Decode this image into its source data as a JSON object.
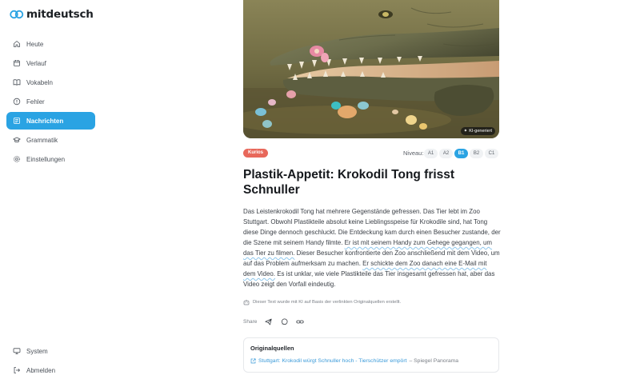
{
  "app": {
    "logo_text": "mitdeutsch"
  },
  "sidebar": {
    "items": [
      {
        "label": "Heute",
        "icon": "home-icon"
      },
      {
        "label": "Verlauf",
        "icon": "calendar-icon"
      },
      {
        "label": "Vokabeln",
        "icon": "book-icon"
      },
      {
        "label": "Fehler",
        "icon": "alert-circle-icon"
      },
      {
        "label": "Nachrichten",
        "icon": "newspaper-icon",
        "active": true
      },
      {
        "label": "Grammatik",
        "icon": "graduation-cap-icon"
      },
      {
        "label": "Einstellungen",
        "icon": "gear-icon"
      }
    ],
    "bottom": [
      {
        "label": "System",
        "icon": "monitor-icon"
      },
      {
        "label": "Abmelden",
        "icon": "logout-icon"
      }
    ]
  },
  "article": {
    "image_badge": "KI-generiert",
    "category": "Kurios",
    "level_label": "Niveau:",
    "levels": [
      "A1",
      "A2",
      "B1",
      "B2",
      "C1"
    ],
    "active_level": "B1",
    "title": "Plastik-Appetit: Krokodil Tong frisst Schnuller",
    "body": {
      "p1": "Das Leistenkrokodil Tong hat mehrere Gegenstände gefressen. Das Tier lebt im Zoo Stuttgart. Obwohl Plastikteile absolut keine Lieblingsspeise für Krokodile sind, hat Tong diese Dinge dennoch geschluckt. Die Entdeckung kam durch einen Besucher zustande, der die Szene mit seinem Handy filmte. ",
      "h1": "Er ist mit seinem Handy zum Gehege gegangen, um das Tier zu filmen.",
      "p2": " Dieser Besucher konfrontierte den Zoo anschließend mit dem Video, um auf das Problem aufmerksam zu machen. ",
      "h2": "Er schickte dem Zoo danach eine E-Mail mit dem Video.",
      "p3": " Es ist unklar, wie viele Plastikteile das Tier insgesamt gefressen hat, aber das Video zeigt den Vorfall eindeutig."
    },
    "ai_note": "Dieser Text wurde mit KI auf Basis der verlinkten Originalquellen erstellt.",
    "share_label": "Share",
    "sources_title": "Originalquellen",
    "source_link": "Stuttgart: Krokodil würgt Schnuller hoch - Tierschützer empört",
    "source_publisher": "– Spiegel Panorama"
  },
  "colors": {
    "accent": "#2aa3e3",
    "category": "#e8685b"
  }
}
